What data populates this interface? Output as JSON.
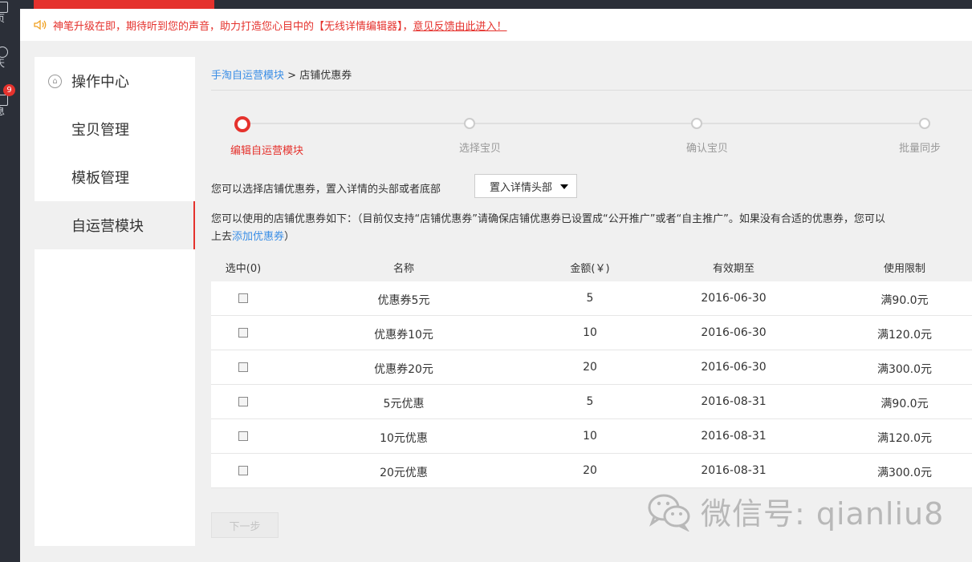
{
  "rail": {
    "items": [
      {
        "label": "页"
      },
      {
        "label": "天"
      },
      {
        "label": "息"
      }
    ],
    "badge": "9"
  },
  "notice": {
    "text": "神笔升级在即，期待听到您的声音，助力打造您心目中的【无线详情编辑器】，",
    "link": "意见反馈由此进入！"
  },
  "sidebar": {
    "items": [
      {
        "label": "操作中心"
      },
      {
        "label": "宝贝管理"
      },
      {
        "label": "模板管理"
      },
      {
        "label": "自运营模块"
      }
    ]
  },
  "breadcrumb": {
    "link": "手淘自运营模块",
    "sep": ">",
    "current": "店铺优惠券"
  },
  "steps": [
    {
      "label": "编辑自运营模块",
      "active": true
    },
    {
      "label": "选择宝贝",
      "active": false
    },
    {
      "label": "确认宝贝",
      "active": false
    },
    {
      "label": "批量同步",
      "active": false
    }
  ],
  "position": {
    "text": "您可以选择店铺优惠券，置入详情的头部或者底部",
    "selected": "置入详情头部"
  },
  "desc": {
    "line1": "您可以使用的店铺优惠券如下：（目前仅支持“店铺优惠券”请确保店铺优惠券已设置成“公开推广”或者“自主推广”。如果没有合适的优惠券，您可以",
    "line2_prefix": "上去",
    "link": "添加优惠券",
    "line2_suffix": "）"
  },
  "table": {
    "headers": [
      "选中(0)",
      "名称",
      "金额(￥)",
      "有效期至",
      "使用限制"
    ],
    "rows": [
      {
        "name": "优惠券5元",
        "amount": "5",
        "expiry": "2016-06-30",
        "limit": "满90.0元"
      },
      {
        "name": "优惠券10元",
        "amount": "10",
        "expiry": "2016-06-30",
        "limit": "满120.0元"
      },
      {
        "name": "优惠券20元",
        "amount": "20",
        "expiry": "2016-06-30",
        "limit": "满300.0元"
      },
      {
        "name": "5元优惠",
        "amount": "5",
        "expiry": "2016-08-31",
        "limit": "满90.0元"
      },
      {
        "name": "10元优惠",
        "amount": "10",
        "expiry": "2016-08-31",
        "limit": "满120.0元"
      },
      {
        "name": "20元优惠",
        "amount": "20",
        "expiry": "2016-08-31",
        "limit": "满300.0元"
      }
    ]
  },
  "next_button": "下一步",
  "watermark": "微信号: qianliu8",
  "colors": {
    "accent": "#e5322d",
    "link": "#3a8ee6",
    "rail": "#2b2f38"
  }
}
